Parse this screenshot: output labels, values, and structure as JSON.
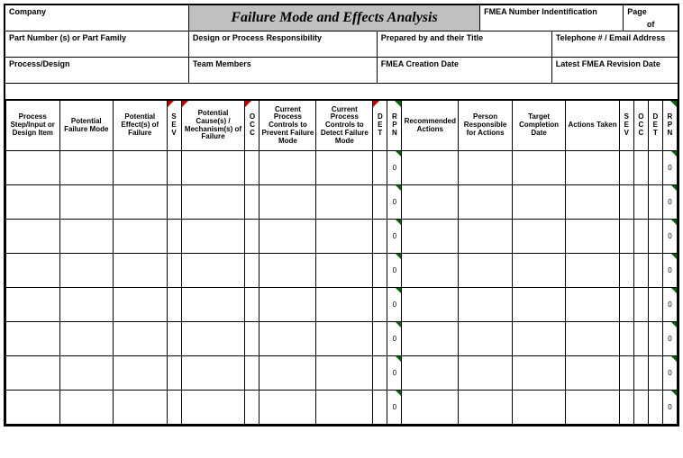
{
  "header": {
    "company": "Company",
    "title": "Failure Mode and Effects Analysis",
    "fmea_number": "FMEA Number Indentification",
    "page": "Page",
    "of": "of",
    "part_number": "Part Number (s) or Part Family",
    "design_resp": "Design or Process Responsibility",
    "prepared_by": "Prepared by and their Title",
    "telephone": "Telephone # / Email Address",
    "process_design": "Process/Design",
    "team_members": "Team Members",
    "creation_date": "FMEA Creation Date",
    "revision_date": "Latest FMEA Revision Date"
  },
  "columns": {
    "process_step": "Process Step/Input or Design Item",
    "failure_mode": "Potential Failure Mode",
    "effects": "Potential Effect(s) of Failure",
    "sev1": "S E V",
    "causes": "Potential Cause(s) / Mechanism(s) of Failure",
    "occ1": "O C C",
    "prevent": "Current Process Controls to Prevent Failure Mode",
    "detect": "Current Process Controls to Detect Failure Mode",
    "det1": "D E T",
    "rpn1": "R P N",
    "recommended": "Recommended Actions",
    "responsible": "Person Responsible for Actions",
    "target_date": "Target Completion Date",
    "actions_taken": "Actions Taken",
    "sev2": "S E V",
    "occ2": "O C C",
    "det2": "D E T",
    "rpn2": "R P N"
  },
  "rows": [
    {
      "rpn1": "0",
      "rpn2": "0"
    },
    {
      "rpn1": "0",
      "rpn2": "0"
    },
    {
      "rpn1": "0",
      "rpn2": "0"
    },
    {
      "rpn1": "0",
      "rpn2": "0"
    },
    {
      "rpn1": "0",
      "rpn2": "0"
    },
    {
      "rpn1": "0",
      "rpn2": "0"
    },
    {
      "rpn1": "0",
      "rpn2": "0"
    },
    {
      "rpn1": "0",
      "rpn2": "0"
    }
  ]
}
